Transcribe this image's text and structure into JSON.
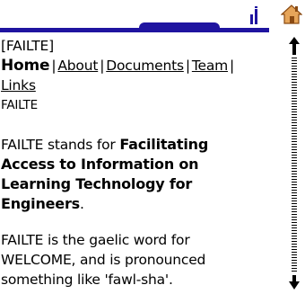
{
  "header": {
    "accent_color": "#1f14a0",
    "home_icon_color": "#c87a2a"
  },
  "content": {
    "page_marker": "[FAILTE]",
    "nav": {
      "current": "Home",
      "links": [
        "About",
        "Documents",
        "Team",
        "Links"
      ],
      "separator": "|"
    },
    "brand": "FAILTE",
    "para1": {
      "lead": "FAILTE stands for ",
      "bold1": "Facilitating",
      "bold2": "Access to Information on",
      "bold3": "Learning Technology for",
      "bold4": "Engineers",
      "tail": "."
    },
    "para2": {
      "line1": "FAILTE is the gaelic word for",
      "line2": "WELCOME, and is pronounced",
      "line3": "something like 'fawl-sha'."
    }
  }
}
